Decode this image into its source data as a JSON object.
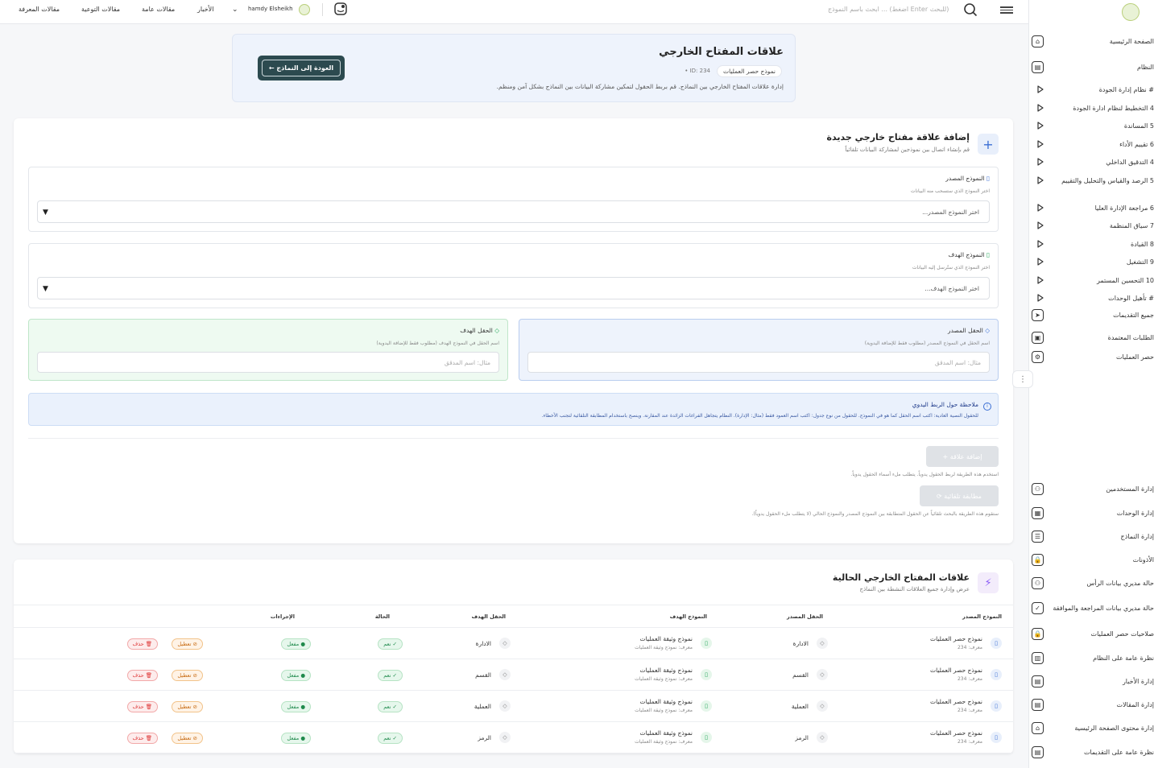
{
  "topbar": {
    "links": [
      "مقالات المعرفة",
      "مقالات التوعية",
      "مقالات عامة",
      "الأخبار"
    ],
    "user_name": "hamdy Elsheikh",
    "search_placeholder": "ابحث باسم النموذج ... (اضغط Enter للبحث)"
  },
  "header": {
    "title": "علاقات المفتاح الخارجي",
    "model_chip": "نموذج حصر العمليات",
    "id_text": "ID: 234",
    "description": "إدارة علاقات المفتاح الخارجي بين النماذج. قم بربط الحقول لتمكين مشاركة البيانات بين النماذج بشكل آمن ومنظم.",
    "back_label": "العودة إلى النماذج"
  },
  "add_form": {
    "title": "إضافة علاقة مفتاح خارجي جديدة",
    "subtitle": "قم بإنشاء اتصال بين نموذجين لمشاركة البيانات تلقائياً",
    "source_model": {
      "label": "النموذج المصدر",
      "hint": "اختر النموذج الذي ستسحب منه البيانات",
      "value": "اختر النموذج المصدر..."
    },
    "target_model": {
      "label": "النموذج الهدف",
      "hint": "اختر النموذج الذي ستُرسل إليه البيانات",
      "value": "اختر النموذج الهدف..."
    },
    "source_field": {
      "label": "الحقل المصدر",
      "hint": "اسم الحقل في النموذج المصدر (مطلوب فقط للإضافة اليدوية)",
      "placeholder": "مثال: اسم المدقق"
    },
    "target_field": {
      "label": "الحقل الهدف",
      "hint": "اسم الحقل في النموذج الهدف (مطلوب فقط للإضافة اليدوية)",
      "placeholder": "مثال: اسم المدقق"
    },
    "note_title": "ملاحظة حول الربط اليدوي",
    "note_text": "للحقول النصية العادية: اكتب اسم الحقل كما هو في النموذج. للحقول من نوع جدول: اكتب اسم العمود فقط (مثال: الإدارة). النظام يتجاهل الفراغات الزائدة عند المقارنة. وينصح باستخدام المطابقة التلقائية لتجنب الأخطاء.",
    "add_button": "إضافة علاقة",
    "add_caption": "استخدم هذه الطريقة لربط الحقول يدوياً. يتطلب ملء أسماء الحقول يدوياً.",
    "auto_button": "مطابقة تلقائية",
    "auto_caption": "ستقوم هذه الطريقة بالبحث تلقائياً عن الحقول المتطابقة بين النموذج المصدر والنموذج الحالي (لا يتطلب ملء الحقول يدوياً)."
  },
  "table": {
    "title": "علاقات المفتاح الخارجي الحالية",
    "subtitle": "عرض وإدارة جميع العلاقات النشطة بين النماذج",
    "headers": [
      "النموذج المصدر",
      "الحقل المصدر",
      "النموذج الهدف",
      "الحقل الهدف",
      "الحالة",
      "الإجراءات"
    ],
    "rows": [
      {
        "src_model": "نموذج حصر العمليات",
        "src_id": "معرف: 234",
        "src_field": "الادارة",
        "tgt_model": "نموذج وثيقة العمليات",
        "tgt_sub": "معرف: نموذج وثيقة العمليات",
        "tgt_field": "الادارة",
        "status": "نعم",
        "enabled": "مفعل",
        "disable": "تعطيل",
        "delete": "حذف"
      },
      {
        "src_model": "نموذج حصر العمليات",
        "src_id": "معرف: 234",
        "src_field": "القسم",
        "tgt_model": "نموذج وثيقة العمليات",
        "tgt_sub": "معرف: نموذج وثيقة العمليات",
        "tgt_field": "القسم",
        "status": "نعم",
        "enabled": "مفعل",
        "disable": "تعطيل",
        "delete": "حذف"
      },
      {
        "src_model": "نموذج حصر العمليات",
        "src_id": "معرف: 234",
        "src_field": "العملية",
        "tgt_model": "نموذج وثيقة العمليات",
        "tgt_sub": "معرف: نموذج وثيقة العمليات",
        "tgt_field": "العملية",
        "status": "نعم",
        "enabled": "مفعل",
        "disable": "تعطيل",
        "delete": "حذف"
      },
      {
        "src_model": "نموذج حصر العمليات",
        "src_id": "معرف: 234",
        "src_field": "الرمز",
        "tgt_model": "نموذج وثيقة العمليات",
        "tgt_sub": "معرف: نموذج وثيقة العمليات",
        "tgt_field": "الرمز",
        "status": "نعم",
        "enabled": "مفعل",
        "disable": "تعطيل",
        "delete": "حذف"
      }
    ]
  },
  "sidebar": {
    "items": [
      {
        "label": "الصفحة الرئيسية",
        "icon": "home-icon"
      },
      {
        "label": "النظام",
        "icon": "document-icon"
      },
      {
        "label": "# نظام إدارة الجودة",
        "icon": "chevron-icon"
      },
      {
        "label": "4 التخطيط لنظام ادارة الجودة",
        "icon": "chevron-icon"
      },
      {
        "label": "5 المساندة",
        "icon": "chevron-icon"
      },
      {
        "label": "6 تقييم الأداء",
        "icon": "chevron-icon"
      },
      {
        "label": "4 التدقيق الداخلي",
        "icon": "chevron-icon"
      },
      {
        "label": "5 الرصد والقياس والتحليل والتقييم",
        "icon": "chevron-icon"
      },
      {
        "label": "6 مراجعة الإدارة العليا",
        "icon": "chevron-icon"
      },
      {
        "label": "7 سياق المنظمة",
        "icon": "chevron-icon"
      },
      {
        "label": "8 القيادة",
        "icon": "chevron-icon"
      },
      {
        "label": "9 التشغيل",
        "icon": "chevron-icon"
      },
      {
        "label": "10 التحسين المستمر",
        "icon": "chevron-icon"
      },
      {
        "label": "# تأهيل الوحدات",
        "icon": "chevron-icon"
      },
      {
        "label": "جميع التقديمات",
        "icon": "send-icon"
      },
      {
        "label": "الطلبات المعتمدة",
        "icon": "image-icon"
      },
      {
        "label": "حصر العمليات",
        "icon": "sliders-icon"
      },
      {
        "label": "إدارة المستخدمين",
        "icon": "users-icon"
      },
      {
        "label": "إدارة الوحدات",
        "icon": "grid-icon"
      },
      {
        "label": "إدارة النماذج",
        "icon": "form-icon"
      },
      {
        "label": "الأذونات",
        "icon": "lock-icon"
      },
      {
        "label": "حالة مديري بيانات الرأس",
        "icon": "user-cog-icon"
      },
      {
        "label": "حالة مديري بيانات المراجعة والموافقة",
        "icon": "check-circle-icon"
      },
      {
        "label": "صلاحيات حصر العمليات",
        "icon": "lock-icon"
      },
      {
        "label": "نظرة عامة على النظام",
        "icon": "chart-icon"
      },
      {
        "label": "إدارة الأخبار",
        "icon": "calendar-icon"
      },
      {
        "label": "إدارة المقالات",
        "icon": "article-icon"
      },
      {
        "label": "إدارة محتوى الصفحة الرئيسية",
        "icon": "home-edit-icon"
      },
      {
        "label": "نظرة عامة على التقديمات",
        "icon": "file-icon"
      }
    ]
  }
}
